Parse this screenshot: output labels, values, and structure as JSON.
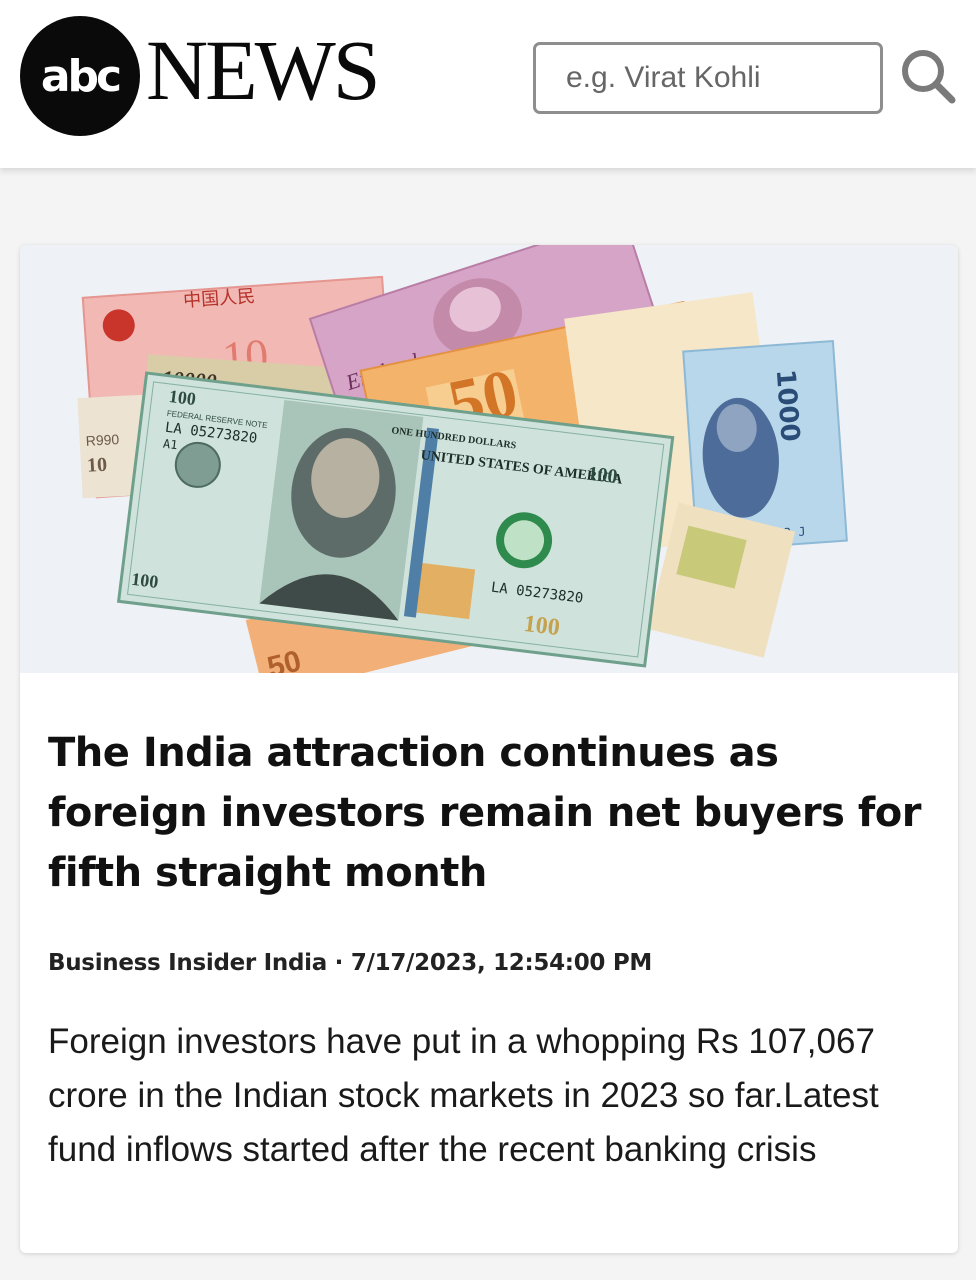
{
  "header": {
    "logo_abc": "abc",
    "logo_news": "NEWS",
    "search_placeholder": "e.g. Virat Kohli",
    "search_icon": "search-icon"
  },
  "article": {
    "image_icon": "currency-banknotes-photo",
    "image_texts": {
      "yuan_chars": "中国人民",
      "yuan_value": "10",
      "pound_word": "England",
      "euro_value": "50",
      "won_value": "1000",
      "won_serial": "B 3188222 J",
      "bill_serial": "LA 05273820",
      "bill_value": "100",
      "bill_series": "A1",
      "small_value": "10000",
      "rand_code": "R990",
      "bottom_value": "50",
      "usa_text": "UNITED STATES OF AMERICA",
      "hundred_words": "ONE HUNDRED DOLLARS",
      "fed_note": "FEDERAL RESERVE NOTE"
    },
    "headline": "The India attraction continues as foreign investors remain net buyers for fifth straight month",
    "source": "Business Insider India",
    "separator": " · ",
    "timestamp": "7/17/2023, 12:54:00 PM",
    "summary": "Foreign investors have put in a whopping Rs 107,067 crore in the Indian stock markets in 2023 so far.Latest fund inflows started after the recent banking crisis"
  },
  "colors": {
    "header_bg": "#ffffff",
    "logo_black": "#0a0a0a",
    "page_bg": "#f4f4f4",
    "card_bg": "#ffffff"
  }
}
